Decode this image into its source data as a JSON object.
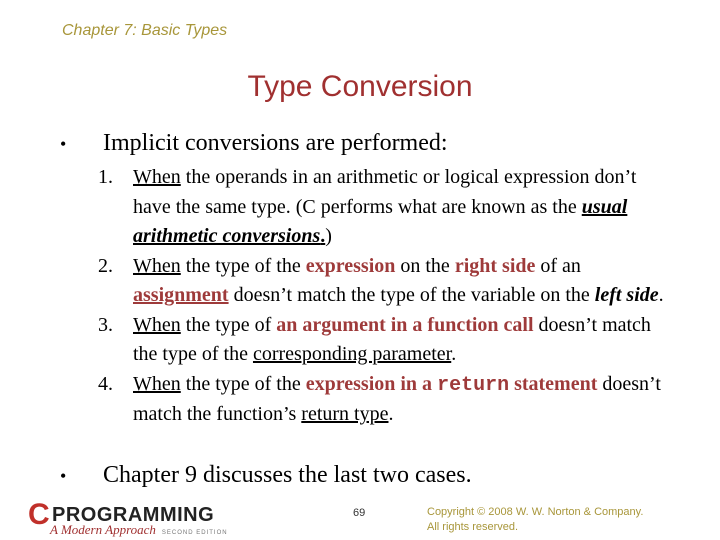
{
  "header": {
    "chapter": "Chapter 7: Basic Types",
    "title": "Type Conversion"
  },
  "bullets": [
    {
      "marker": "•",
      "text": "Implicit conversions are performed:"
    },
    {
      "marker": "•",
      "text": "Chapter 9 discusses the last two cases."
    }
  ],
  "items": [
    {
      "num": "1.",
      "parts": [
        "When",
        " the operands in an arithmetic or logical expression don’t have the same type. (C performs what are known as the ",
        "usual arithmetic conversions",
        ".",
        ")"
      ]
    },
    {
      "num": "2.",
      "parts": [
        "When",
        " the type of the ",
        "expression",
        " on the ",
        "right side",
        " of an ",
        "assignment",
        " doesn’t match the type of the variable on the ",
        "left side",
        "."
      ]
    },
    {
      "num": "3.",
      "parts": [
        "When",
        " the type of ",
        "an argument in a function call",
        " doesn’t match the type of the ",
        "corresponding parameter",
        "."
      ]
    },
    {
      "num": "4.",
      "parts": [
        "When",
        " the type of the ",
        "expression in a ",
        "return",
        " statement",
        " doesn’t match the function’s ",
        "return type",
        "."
      ]
    }
  ],
  "footer": {
    "logo_letter": "C",
    "logo_word": "PROGRAMMING",
    "logo_subtitle": "A Modern Approach",
    "logo_edition": "SECOND EDITION",
    "page_number": "69",
    "copyright_line1": "Copyright © 2008 W. W. Norton & Company.",
    "copyright_line2": "All rights reserved."
  },
  "colors": {
    "accent_red": "#9e3a3a",
    "title_red": "#a03030",
    "gold": "#a8963a"
  }
}
